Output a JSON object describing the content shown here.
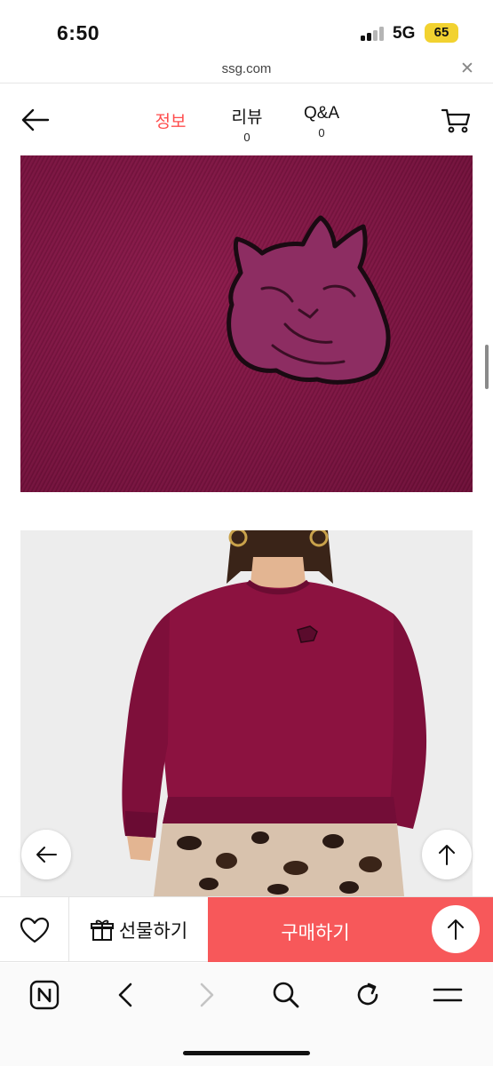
{
  "status_bar": {
    "time": "6:50",
    "network": "5G",
    "battery": "65",
    "battery_color": "#f2d230"
  },
  "browser": {
    "url": "ssg.com",
    "close_icon": "close-icon"
  },
  "header": {
    "back_icon": "arrow-left-icon",
    "tabs": [
      {
        "label": "정보",
        "count": "",
        "active": true
      },
      {
        "label": "리뷰",
        "count": "0",
        "active": false
      },
      {
        "label": "Q&A",
        "count": "0",
        "active": false
      }
    ],
    "cart_icon": "cart-icon",
    "active_color": "#ff4d4d"
  },
  "product_images": {
    "closeup_icon": "fox-head-patch",
    "product_color": "#7e1541"
  },
  "floating_buttons": {
    "prev_icon": "arrow-left-icon",
    "scroll_top_icon": "arrow-up-icon"
  },
  "purchase_bar": {
    "like_icon": "heart-icon",
    "gift_label": "선물하기",
    "gift_icon": "gift-icon",
    "buy_label": "구매하기",
    "buy_color": "#f7585a",
    "top_icon": "arrow-up-icon"
  },
  "toolbar": {
    "items": [
      "naver-icon",
      "back-icon",
      "forward-icon",
      "search-icon",
      "reload-icon",
      "menu-icon"
    ]
  }
}
